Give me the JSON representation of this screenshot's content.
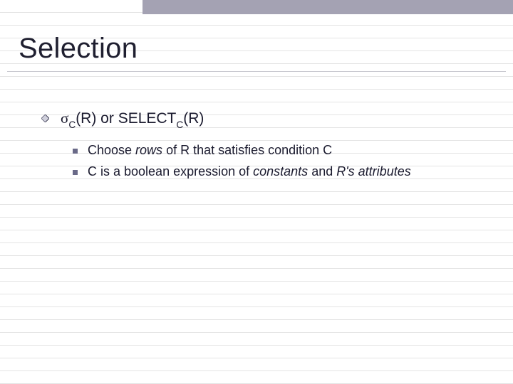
{
  "title": "Selection",
  "lvl1": {
    "sigma": "σ",
    "sub1": "C",
    "arg1": "(R)",
    "or": " or ",
    "select": "SELECT",
    "sub2": "C",
    "arg2": "(R)"
  },
  "lvl2": [
    {
      "pre": "Choose ",
      "it1": "rows ",
      "post": "of R that satisfies condition C"
    },
    {
      "pre": "C is a boolean expression of ",
      "it1": "constants ",
      "mid": "and ",
      "it2": "R's attributes"
    }
  ]
}
